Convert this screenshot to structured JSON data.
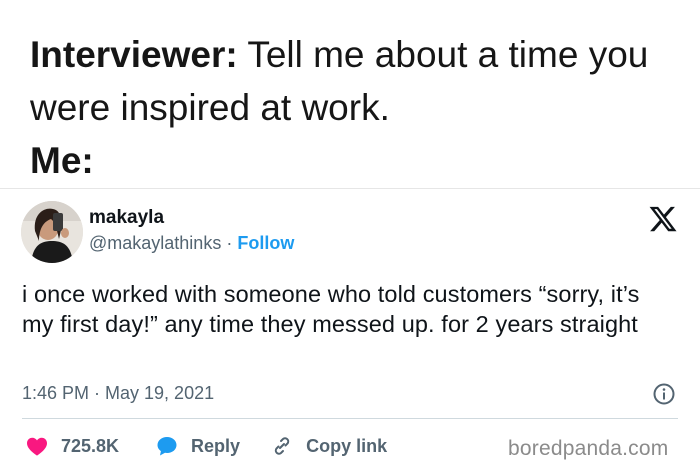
{
  "caption": {
    "interviewer_label": "Interviewer:",
    "question": " Tell me about a time you were inspired at work.",
    "me_label": "Me:"
  },
  "tweet": {
    "display_name": "makayla",
    "handle": "@makaylathinks",
    "separator": " · ",
    "follow_label": "Follow",
    "text": "i once worked with someone who told customers “sorry, it’s my first day!” any time they messed up. for 2 years straight",
    "timestamp": "1:46 PM · May 19, 2021",
    "likes": "725.8K",
    "reply_label": "Reply",
    "copy_link_label": "Copy link"
  },
  "icons": {
    "platform": "x-logo-icon",
    "info": "info-icon",
    "like": "heart-icon",
    "reply": "speech-bubble-icon",
    "copy_link": "link-icon"
  },
  "colors": {
    "accent": "#1d9bf0",
    "like": "#f91880",
    "muted": "#536471",
    "text": "#0f1419"
  },
  "watermark": "boredpanda.com"
}
